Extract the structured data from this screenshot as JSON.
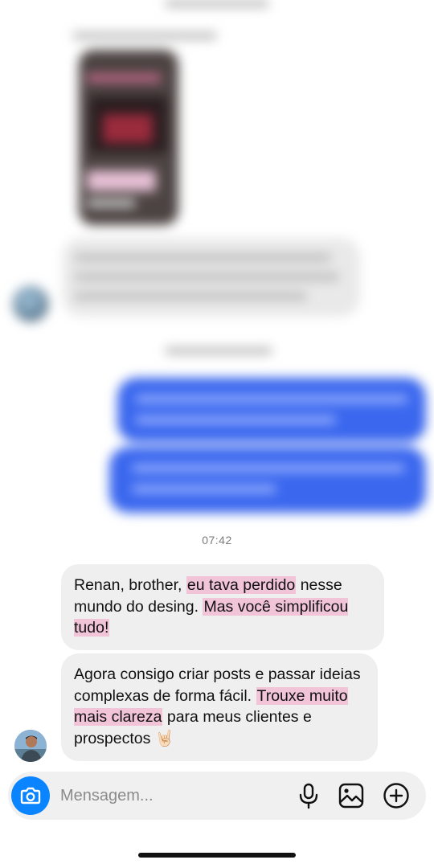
{
  "chat": {
    "timestamp": "07:42",
    "messages": [
      {
        "segments": [
          {
            "text": "Renan, brother, ",
            "highlight": false
          },
          {
            "text": "eu tava perdido",
            "highlight": true
          },
          {
            "text": " nesse mundo do desing. ",
            "highlight": false
          },
          {
            "text": "Mas você simplificou tudo!",
            "highlight": true
          }
        ]
      },
      {
        "segments": [
          {
            "text": "Agora consigo criar posts e passar ideias complexas de forma fácil. ",
            "highlight": false
          },
          {
            "text": "Trouxe muito mais clareza",
            "highlight": true
          },
          {
            "text": " para meus clientes e prospectos ",
            "highlight": false
          }
        ],
        "emoji": "🤘🏻"
      }
    ]
  },
  "composer": {
    "placeholder": "Mensagem...",
    "icons": [
      "camera-icon",
      "microphone-icon",
      "gallery-icon",
      "add-icon"
    ]
  },
  "colors": {
    "incoming_bubble": "#efefef",
    "outgoing_bubble": "#3a67ee",
    "highlight": "#f1c4d8",
    "camera_button": "#0a84ff"
  }
}
